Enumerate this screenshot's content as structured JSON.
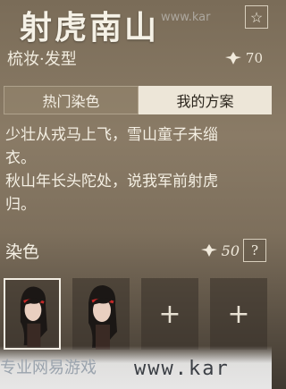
{
  "header": {
    "title": "射虎南山",
    "subtitle": "梳妆·发型",
    "cost_value": "70"
  },
  "tabs": [
    {
      "label": "热门染色",
      "active": false
    },
    {
      "label": "我的方案",
      "active": true
    }
  ],
  "description": {
    "line1": "少壮从戎马上飞，雪山童子未缁",
    "line2": "衣。",
    "line3": "秋山年长头陀处，说我军前射虎",
    "line4": "归。"
  },
  "dye": {
    "label": "染色",
    "count": "50",
    "help_symbol": "?"
  },
  "slots": [
    {
      "type": "character",
      "selected": true
    },
    {
      "type": "character",
      "selected": false
    },
    {
      "type": "add",
      "symbol": "+"
    },
    {
      "type": "add",
      "symbol": "+"
    }
  ],
  "watermark": {
    "text": "专业网易游戏",
    "url": "www.kar",
    "top_text": "www.kar"
  },
  "icons": {
    "favorite": "star-icon",
    "currency": "gem-icon"
  },
  "colors": {
    "tab_active_bg": "#ede6d8",
    "text_light": "#f3eee2"
  }
}
